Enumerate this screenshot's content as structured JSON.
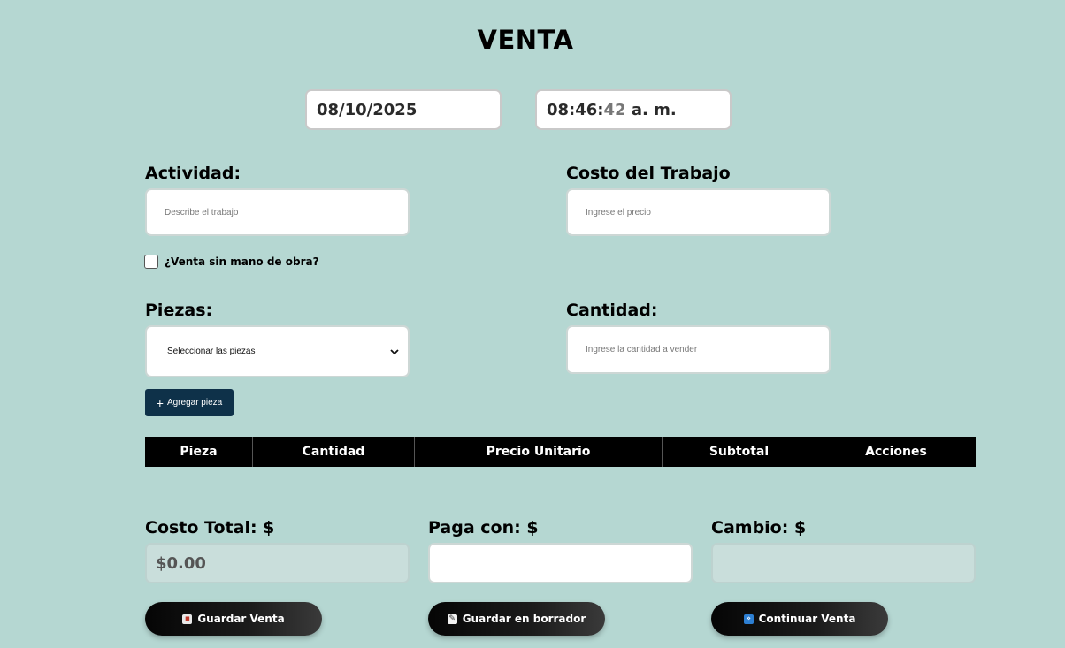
{
  "title": "VENTA",
  "date": "08/10/2025",
  "time": {
    "hm": "08:46:",
    "sec": "42",
    "ampm": " a. m."
  },
  "actividad": {
    "label": "Actividad:",
    "placeholder": "Describe el trabajo"
  },
  "costo_trabajo": {
    "label": "Costo del Trabajo",
    "placeholder": "Ingrese el precio"
  },
  "sin_mano_obra": {
    "label": "¿Venta sin mano de obra?",
    "checked": false
  },
  "piezas": {
    "label": "Piezas:",
    "selected": "Seleccionar las piezas"
  },
  "cantidad": {
    "label": "Cantidad:",
    "placeholder": "Ingrese la cantidad a vender"
  },
  "add_piece_button": "Agregar pieza",
  "table": {
    "columns": [
      "Pieza",
      "Cantidad",
      "Precio Unitario",
      "Subtotal",
      "Acciones"
    ],
    "rows": []
  },
  "totals": {
    "costo_total": {
      "label": "Costo Total: $",
      "value": "$0.00"
    },
    "paga_con": {
      "label": "Paga con: $",
      "value": ""
    },
    "cambio": {
      "label": "Cambio: $",
      "value": ""
    }
  },
  "buttons": {
    "guardar": {
      "label": "Guardar Venta",
      "icon": "save-icon"
    },
    "borrador": {
      "label": "Guardar en borrador",
      "icon": "memo-icon"
    },
    "continuar": {
      "label": "Continuar Venta",
      "icon": "fast-forward-icon"
    }
  },
  "colors": {
    "background": "#b5d7d2",
    "add_button": "#0e3149",
    "table_header": "#000000",
    "action_button": "#111111"
  }
}
